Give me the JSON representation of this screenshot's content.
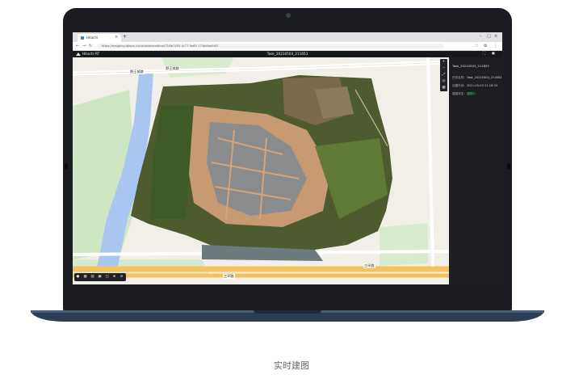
{
  "browser": {
    "tab_title": "Hitachi",
    "tab_close": "×",
    "tab_new": "+",
    "window_controls": [
      "–",
      "□",
      "×"
    ],
    "nav_icons": [
      "←",
      "→",
      "↻"
    ],
    "url": "https://mapping.djiops.cn/console/realtime/?24fb7455-4c77-9a65-174bbfae94f2",
    "toolbar_icons": [
      "☆",
      "⚙",
      "⋮"
    ]
  },
  "app": {
    "brand": "Hitachi RT",
    "task_title": "Task_20210503_211853",
    "header_icons": [
      "⛶",
      "●"
    ]
  },
  "map": {
    "road_labels": [
      "野王城路",
      "野王城路",
      "三环路",
      "三环路"
    ],
    "tools": [
      "+",
      "−",
      "⤢",
      "◎",
      "▦"
    ],
    "bottom_buttons": [
      "●",
      "▦",
      "▤",
      "▣",
      "◫",
      "⊕",
      "⊖"
    ]
  },
  "side_panel": {
    "title": "Task_20210503_211853",
    "rows": [
      {
        "label": "任务名称：",
        "value": "Task_20210503_211853"
      },
      {
        "label": "创建时间：",
        "value": "2021-05-03 21:18:53"
      },
      {
        "label": "建图状态：",
        "value": "建图中"
      }
    ],
    "status_color": "#3bd16f"
  },
  "caption": "实时建图"
}
